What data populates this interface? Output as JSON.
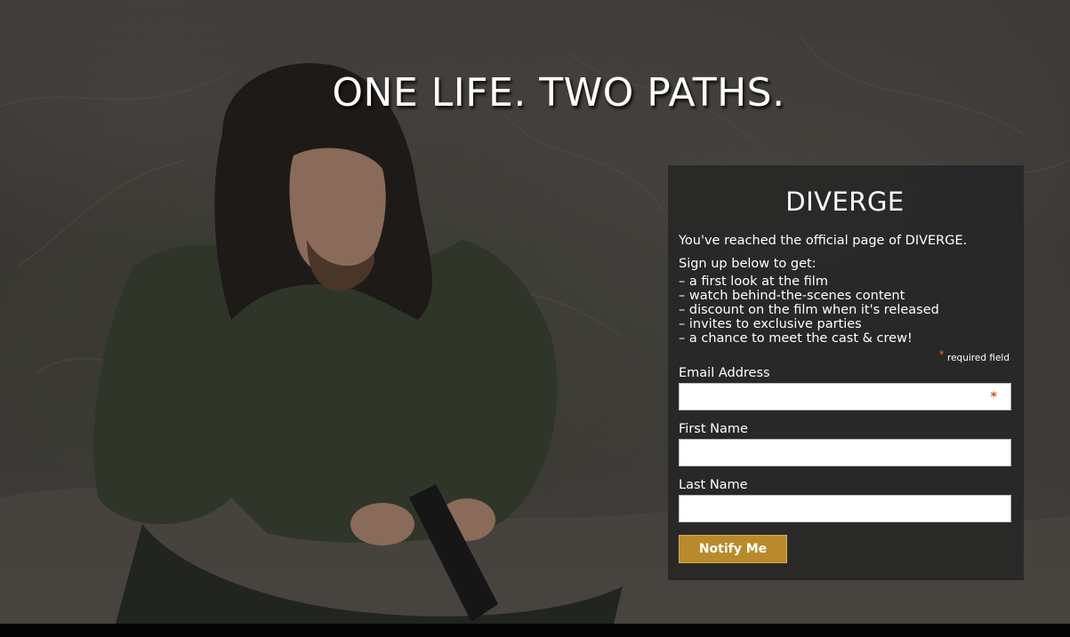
{
  "headline": "ONE LIFE. TWO PATHS.",
  "panel": {
    "title": "DIVERGE",
    "intro": "You've reached the official page of DIVERGE.",
    "signup_label": "Sign up below to get:",
    "benefits": [
      "a first look at the film",
      "watch behind-the-scenes content",
      "discount on the film when it's released",
      "invites to exclusive parties",
      "a chance to meet the cast & crew!"
    ],
    "required_marker": "*",
    "required_note": "required field"
  },
  "form": {
    "email": {
      "label": "Email Address",
      "value": "",
      "required_marker": "*"
    },
    "first_name": {
      "label": "First Name",
      "value": ""
    },
    "last_name": {
      "label": "Last Name",
      "value": ""
    },
    "submit_label": "Notify Me"
  },
  "colors": {
    "button": "#b88a2c",
    "required": "#e0642a",
    "panel_bg": "#262626"
  }
}
